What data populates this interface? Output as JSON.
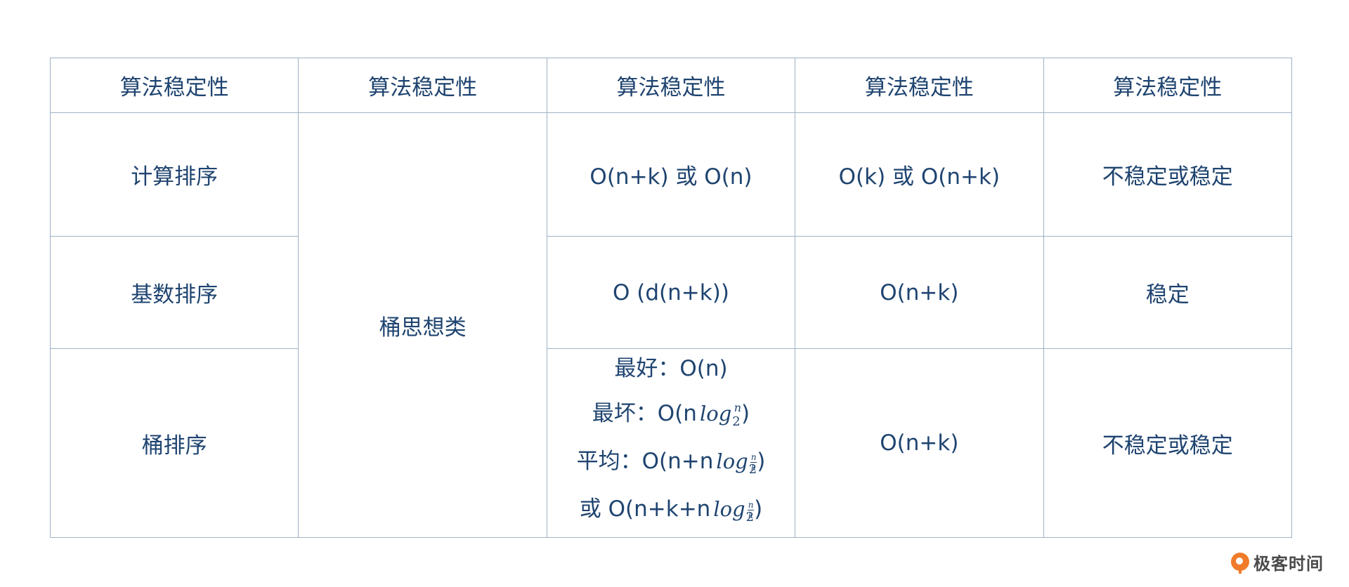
{
  "table": {
    "headers": [
      "算法稳定性",
      "算法稳定性",
      "算法稳定性",
      "算法稳定性",
      "算法稳定性"
    ],
    "group_label": "桶思想类",
    "rows": [
      {
        "name": "计算排序",
        "time": "O(n+k) 或 O(n)",
        "space": "O(k) 或 O(n+k)",
        "stability": "不稳定或稳定"
      },
      {
        "name": "基数排序",
        "time": "O (d(n+k))",
        "space": "O(n+k)",
        "stability": "稳定"
      },
      {
        "name": "桶排序",
        "time_lines": {
          "best": "最好：O(n)",
          "worst_prefix": "最坏：O(n",
          "avg_prefix": "平均：O(n+n",
          "alt_prefix": "或 O(n+k+n",
          "log": "log",
          "base": "2",
          "n": "n",
          "k": "k",
          "close": ")"
        },
        "space": "O(n+k)",
        "stability": "不稳定或稳定"
      }
    ]
  },
  "brand": {
    "name": "极客时间",
    "accent_color": "#f07b2a",
    "icon": "geektime-logo-icon"
  }
}
